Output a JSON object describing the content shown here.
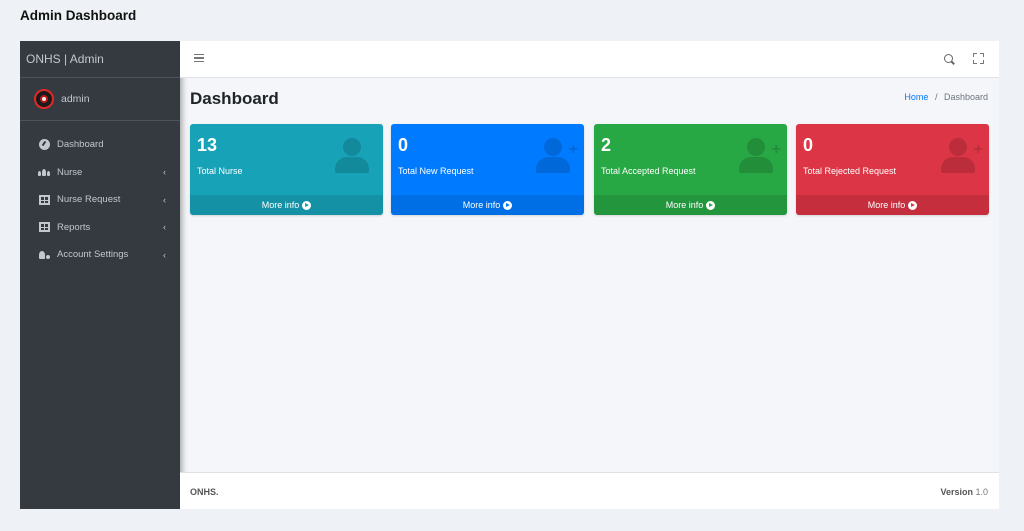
{
  "page_heading": "Admin Dashboard",
  "sidebar": {
    "brand": "ONHS | Admin",
    "user": "admin",
    "items": [
      {
        "label": "Dashboard",
        "icon": "tachometer-icon",
        "caret": ""
      },
      {
        "label": "Nurse",
        "icon": "users-icon",
        "caret": "‹"
      },
      {
        "label": "Nurse Request",
        "icon": "table-icon",
        "caret": "‹"
      },
      {
        "label": "Reports",
        "icon": "table-icon",
        "caret": "‹"
      },
      {
        "label": "Account Settings",
        "icon": "user-cog-icon",
        "caret": "‹"
      }
    ]
  },
  "content": {
    "title": "Dashboard",
    "breadcrumb": {
      "home": "Home",
      "separator": "/",
      "current": "Dashboard"
    }
  },
  "boxes": [
    {
      "value": "13",
      "label": "Total Nurse",
      "footer": "More info",
      "color": "#17a2b8",
      "icon": "user-icon"
    },
    {
      "value": "0",
      "label": "Total New Request",
      "footer": "More info",
      "color": "#007bff",
      "icon": "user-plus-icon"
    },
    {
      "value": "2",
      "label": "Total Accepted Request",
      "footer": "More info",
      "color": "#28a745",
      "icon": "user-plus-icon"
    },
    {
      "value": "0",
      "label": "Total Rejected Request",
      "footer": "More info",
      "color": "#dc3545",
      "icon": "user-plus-icon"
    }
  ],
  "footer": {
    "left": "ONHS.",
    "version_label": "Version",
    "version": "1.0"
  }
}
